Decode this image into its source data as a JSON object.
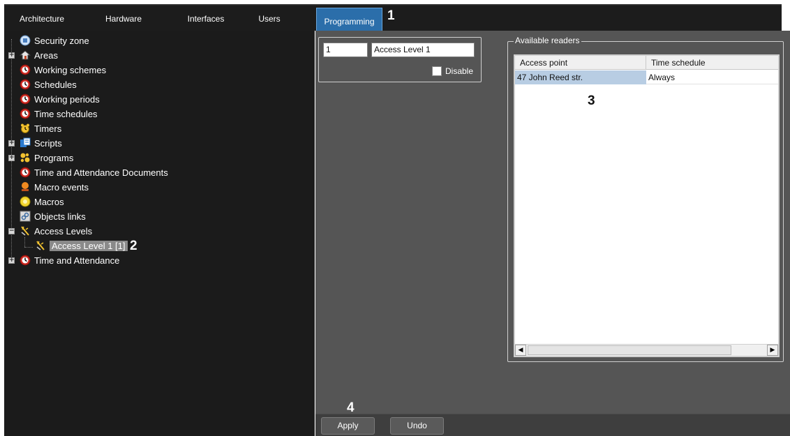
{
  "tabs": [
    {
      "label": "Architecture",
      "active": false
    },
    {
      "label": "Hardware",
      "active": false
    },
    {
      "label": "Interfaces",
      "active": false
    },
    {
      "label": "Users",
      "active": false
    },
    {
      "label": "Programming",
      "active": true
    }
  ],
  "callouts": {
    "one": "1",
    "two": "2",
    "three": "3",
    "four": "4"
  },
  "tree": {
    "items": [
      {
        "label": "Security zone",
        "icon": "security-zone-icon",
        "expandable": false
      },
      {
        "label": "Areas",
        "icon": "house-icon",
        "expandable": true
      },
      {
        "label": "Working schemes",
        "icon": "clock-icon",
        "expandable": false
      },
      {
        "label": "Schedules",
        "icon": "clock-icon",
        "expandable": false
      },
      {
        "label": "Working periods",
        "icon": "clock-icon",
        "expandable": false
      },
      {
        "label": "Time schedules",
        "icon": "clock-icon",
        "expandable": false
      },
      {
        "label": "Timers",
        "icon": "alarm-clock-icon",
        "expandable": false
      },
      {
        "label": "Scripts",
        "icon": "scripts-icon",
        "expandable": true
      },
      {
        "label": "Programs",
        "icon": "programs-icon",
        "expandable": true
      },
      {
        "label": "Time and Attendance Documents",
        "icon": "clock-icon",
        "expandable": false
      },
      {
        "label": "Macro events",
        "icon": "macro-event-icon",
        "expandable": false
      },
      {
        "label": "Macros",
        "icon": "macros-icon",
        "expandable": false
      },
      {
        "label": "Objects links",
        "icon": "link-icon",
        "expandable": false
      },
      {
        "label": "Access Levels",
        "icon": "key-icon",
        "expandable": true,
        "expanded": true
      },
      {
        "label": "Access Level 1 [1]",
        "icon": "key-icon",
        "expandable": false,
        "child": true,
        "selected": true
      },
      {
        "label": "Time and Attendance",
        "icon": "clock-icon",
        "expandable": true
      }
    ]
  },
  "access_level": {
    "id_value": "1",
    "name_value": "Access Level 1",
    "disable_label": "Disable",
    "disable_checked": false
  },
  "readers": {
    "legend": "Available readers",
    "columns": [
      "Access point",
      "Time schedule"
    ],
    "rows": [
      {
        "access_point": "47 John Reed str.",
        "time_schedule": "Always",
        "selected": true
      }
    ]
  },
  "buttons": {
    "apply": "Apply",
    "undo": "Undo"
  },
  "colors": {
    "accent_tab": "#2b6eaa",
    "selection": "#b8cde3",
    "tree_bg": "#1b1b1b",
    "panel_bg": "#555555"
  }
}
